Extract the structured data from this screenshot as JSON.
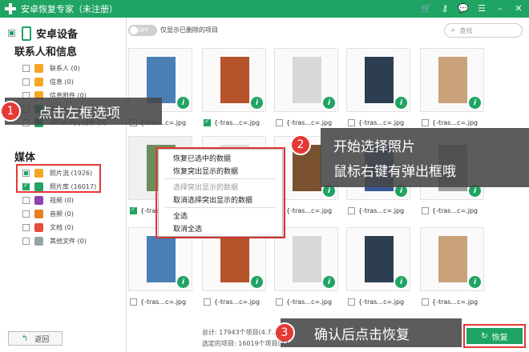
{
  "app": {
    "title": "安卓恢复专家（未注册）"
  },
  "toolbar_icons": [
    "cart-icon",
    "key-icon",
    "chat-icon",
    "menu-icon",
    "minimize-icon",
    "close-icon"
  ],
  "sidebar": {
    "device": "安卓设备",
    "contacts_section": "联系人和信息",
    "contacts_items": [
      {
        "label": "联系人 (0)",
        "icon": "contacts-icon",
        "color": "#f5a623"
      },
      {
        "label": "信息 (0)",
        "icon": "messages-icon",
        "color": "#f5a623"
      },
      {
        "label": "信息附件 (0)",
        "icon": "attachment-icon",
        "color": "#f5a623"
      },
      {
        "label": "WhatsApp (0)",
        "icon": "whatsapp-icon",
        "color": "#1fa463"
      },
      {
        "label": "WhatsApp附件 (0)",
        "icon": "whatsapp-attachment-icon",
        "color": "#1fa463"
      }
    ],
    "media_section": "媒体",
    "media_items": [
      {
        "label": "照片流 (1926)",
        "icon": "photostream-icon",
        "color": "#f5a623"
      },
      {
        "label": "照片库 (16017)",
        "icon": "photolibrary-icon",
        "color": "#1fa463"
      },
      {
        "label": "视频 (0)",
        "icon": "video-icon",
        "color": "#8e44ad"
      },
      {
        "label": "音频 (0)",
        "icon": "audio-icon",
        "color": "#e67e22"
      },
      {
        "label": "文档 (0)",
        "icon": "document-icon",
        "color": "#e74c3c"
      },
      {
        "label": "其他文件 (0)",
        "icon": "other-files-icon",
        "color": "#95a5a6"
      }
    ],
    "back_label": "返回"
  },
  "main": {
    "toggle_label": "OFF",
    "only_deleted": "仅显示已删除的项目",
    "search_placeholder": "查找",
    "filename": "{-tras...c=.jpg",
    "grid_rows": [
      {
        "checked": [
          false,
          true,
          false,
          false,
          false,
          false
        ]
      },
      {
        "checked": [
          true,
          false,
          false,
          false,
          false,
          false
        ]
      },
      {
        "checked": [
          false,
          false,
          false,
          false,
          false,
          false
        ]
      }
    ]
  },
  "context_menu": {
    "items": [
      {
        "label": "恢复已选中的数据",
        "disabled": false
      },
      {
        "label": "恢复突出显示的数据",
        "disabled": false
      },
      {
        "label": "选择突出显示的数据",
        "disabled": true
      },
      {
        "label": "取消选择突出显示的数据",
        "disabled": false
      },
      {
        "label": "全选",
        "disabled": false
      },
      {
        "label": "取消全选",
        "disabled": false
      }
    ]
  },
  "annotations": {
    "step1": {
      "num": "1",
      "text": "点击左框选项"
    },
    "step2": {
      "num": "2",
      "line1": "开始选择照片",
      "line2": "鼠标右键有弹出框哦"
    },
    "step3": {
      "num": "3",
      "text": "确认后点击恢复"
    }
  },
  "status": {
    "total": "总计: 17943个项目(4.7...",
    "selected": "选定的项目: 16019个项目(23.7... )"
  },
  "restore_label": "恢复",
  "colors": {
    "accent": "#1fa463",
    "highlight": "#e53935"
  }
}
